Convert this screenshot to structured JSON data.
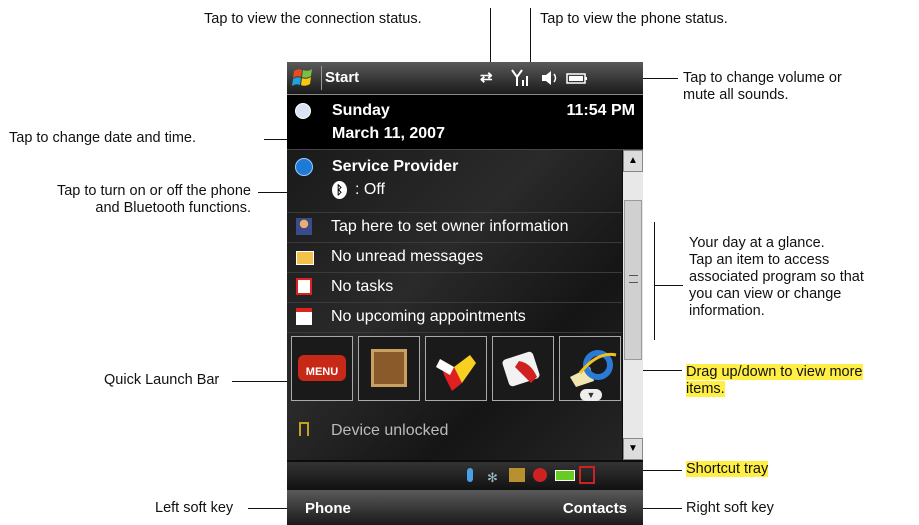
{
  "annotations": {
    "connection_status": "Tap to view the connection status.",
    "phone_status": "Tap to view the phone status.",
    "volume_line1": "Tap to change volume or",
    "volume_line2": "mute all sounds.",
    "date_time": "Tap to change date and time.",
    "phone_bt_line1": "Tap to turn on or off the phone",
    "phone_bt_line2": "and Bluetooth functions.",
    "glance_line1": "Your day at a glance.",
    "glance_line2": "Tap an item to access",
    "glance_line3": "associated program so that",
    "glance_line4": "you can view or change",
    "glance_line5": "information.",
    "quick_launch": "Quick Launch Bar",
    "drag_line1": "Drag up/down to view more",
    "drag_line2": "items.",
    "shortcut_tray": "Shortcut tray",
    "left_soft_key": "Left soft key",
    "right_soft_key": "Right soft key"
  },
  "nav": {
    "start_label": "Start"
  },
  "today": {
    "day": "Sunday",
    "date": "March 11, 2007",
    "time": "11:54 PM",
    "provider": "Service Provider",
    "bluetooth": ": Off",
    "rows": [
      "Tap here to set owner information",
      "No unread messages",
      "No tasks",
      "No upcoming appointments"
    ],
    "device_status": "Device unlocked"
  },
  "quick_launch": {
    "first_tile_label": "MENU"
  },
  "softkeys": {
    "left": "Phone",
    "right": "Contacts"
  },
  "colors": {
    "highlight": "#ffee44"
  }
}
